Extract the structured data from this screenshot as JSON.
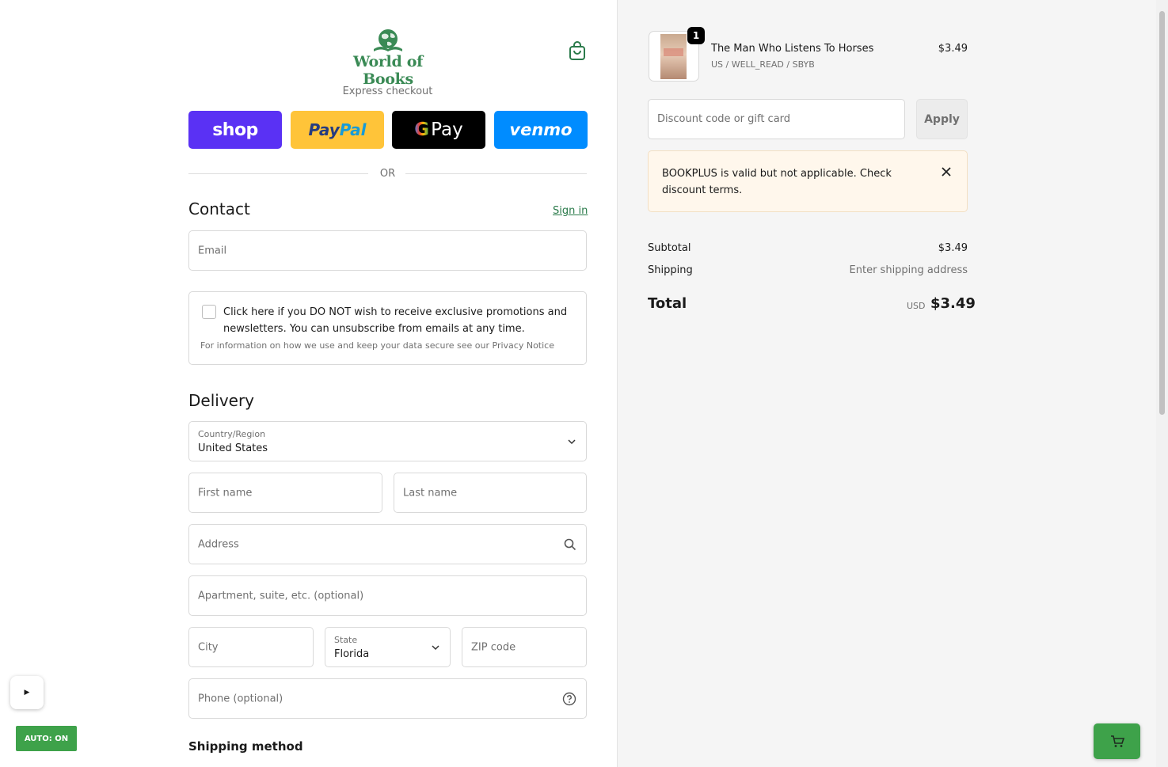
{
  "brand": {
    "name": "World of Books",
    "accent": "#3a8a55"
  },
  "express": {
    "title": "Express checkout",
    "shop_label": "shop",
    "paypal_label_a": "Pay",
    "paypal_label_b": "Pal",
    "gpay_g": "G",
    "gpay_label": "Pay",
    "venmo_label": "venmo"
  },
  "divider": {
    "or": "OR"
  },
  "contact": {
    "title": "Contact",
    "sign_in": "Sign in",
    "email_placeholder": "Email",
    "consent_text": "Click here if you DO NOT wish to receive exclusive promotions and newsletters. You can unsubscribe from emails at any time.",
    "consent_note": "For information on how we use and keep your data secure see our Privacy Notice"
  },
  "delivery": {
    "title": "Delivery",
    "country_label": "Country/Region",
    "country_value": "United States",
    "first_name": "First name",
    "last_name": "Last name",
    "address": "Address",
    "apartment": "Apartment, suite, etc. (optional)",
    "city": "City",
    "state_label": "State",
    "state_value": "Florida",
    "zip": "ZIP code",
    "phone": "Phone (optional)"
  },
  "shipping_method": {
    "title": "Shipping method"
  },
  "tools": {
    "play": "▶",
    "auto": "AUTO: ON"
  },
  "summary": {
    "product": {
      "quantity": "1",
      "title": "The Man Who Listens To Horses",
      "variant": "US / WELL_READ / SBYB",
      "price": "$3.49"
    },
    "discount_placeholder": "Discount code or gift card",
    "apply": "Apply",
    "notice": "BOOKPLUS is valid but not applicable. Check discount terms.",
    "subtotal_label": "Subtotal",
    "subtotal_value": "$3.49",
    "shipping_label": "Shipping",
    "shipping_value": "Enter shipping address",
    "total_label": "Total",
    "currency": "USD",
    "total_value": "$3.49"
  }
}
